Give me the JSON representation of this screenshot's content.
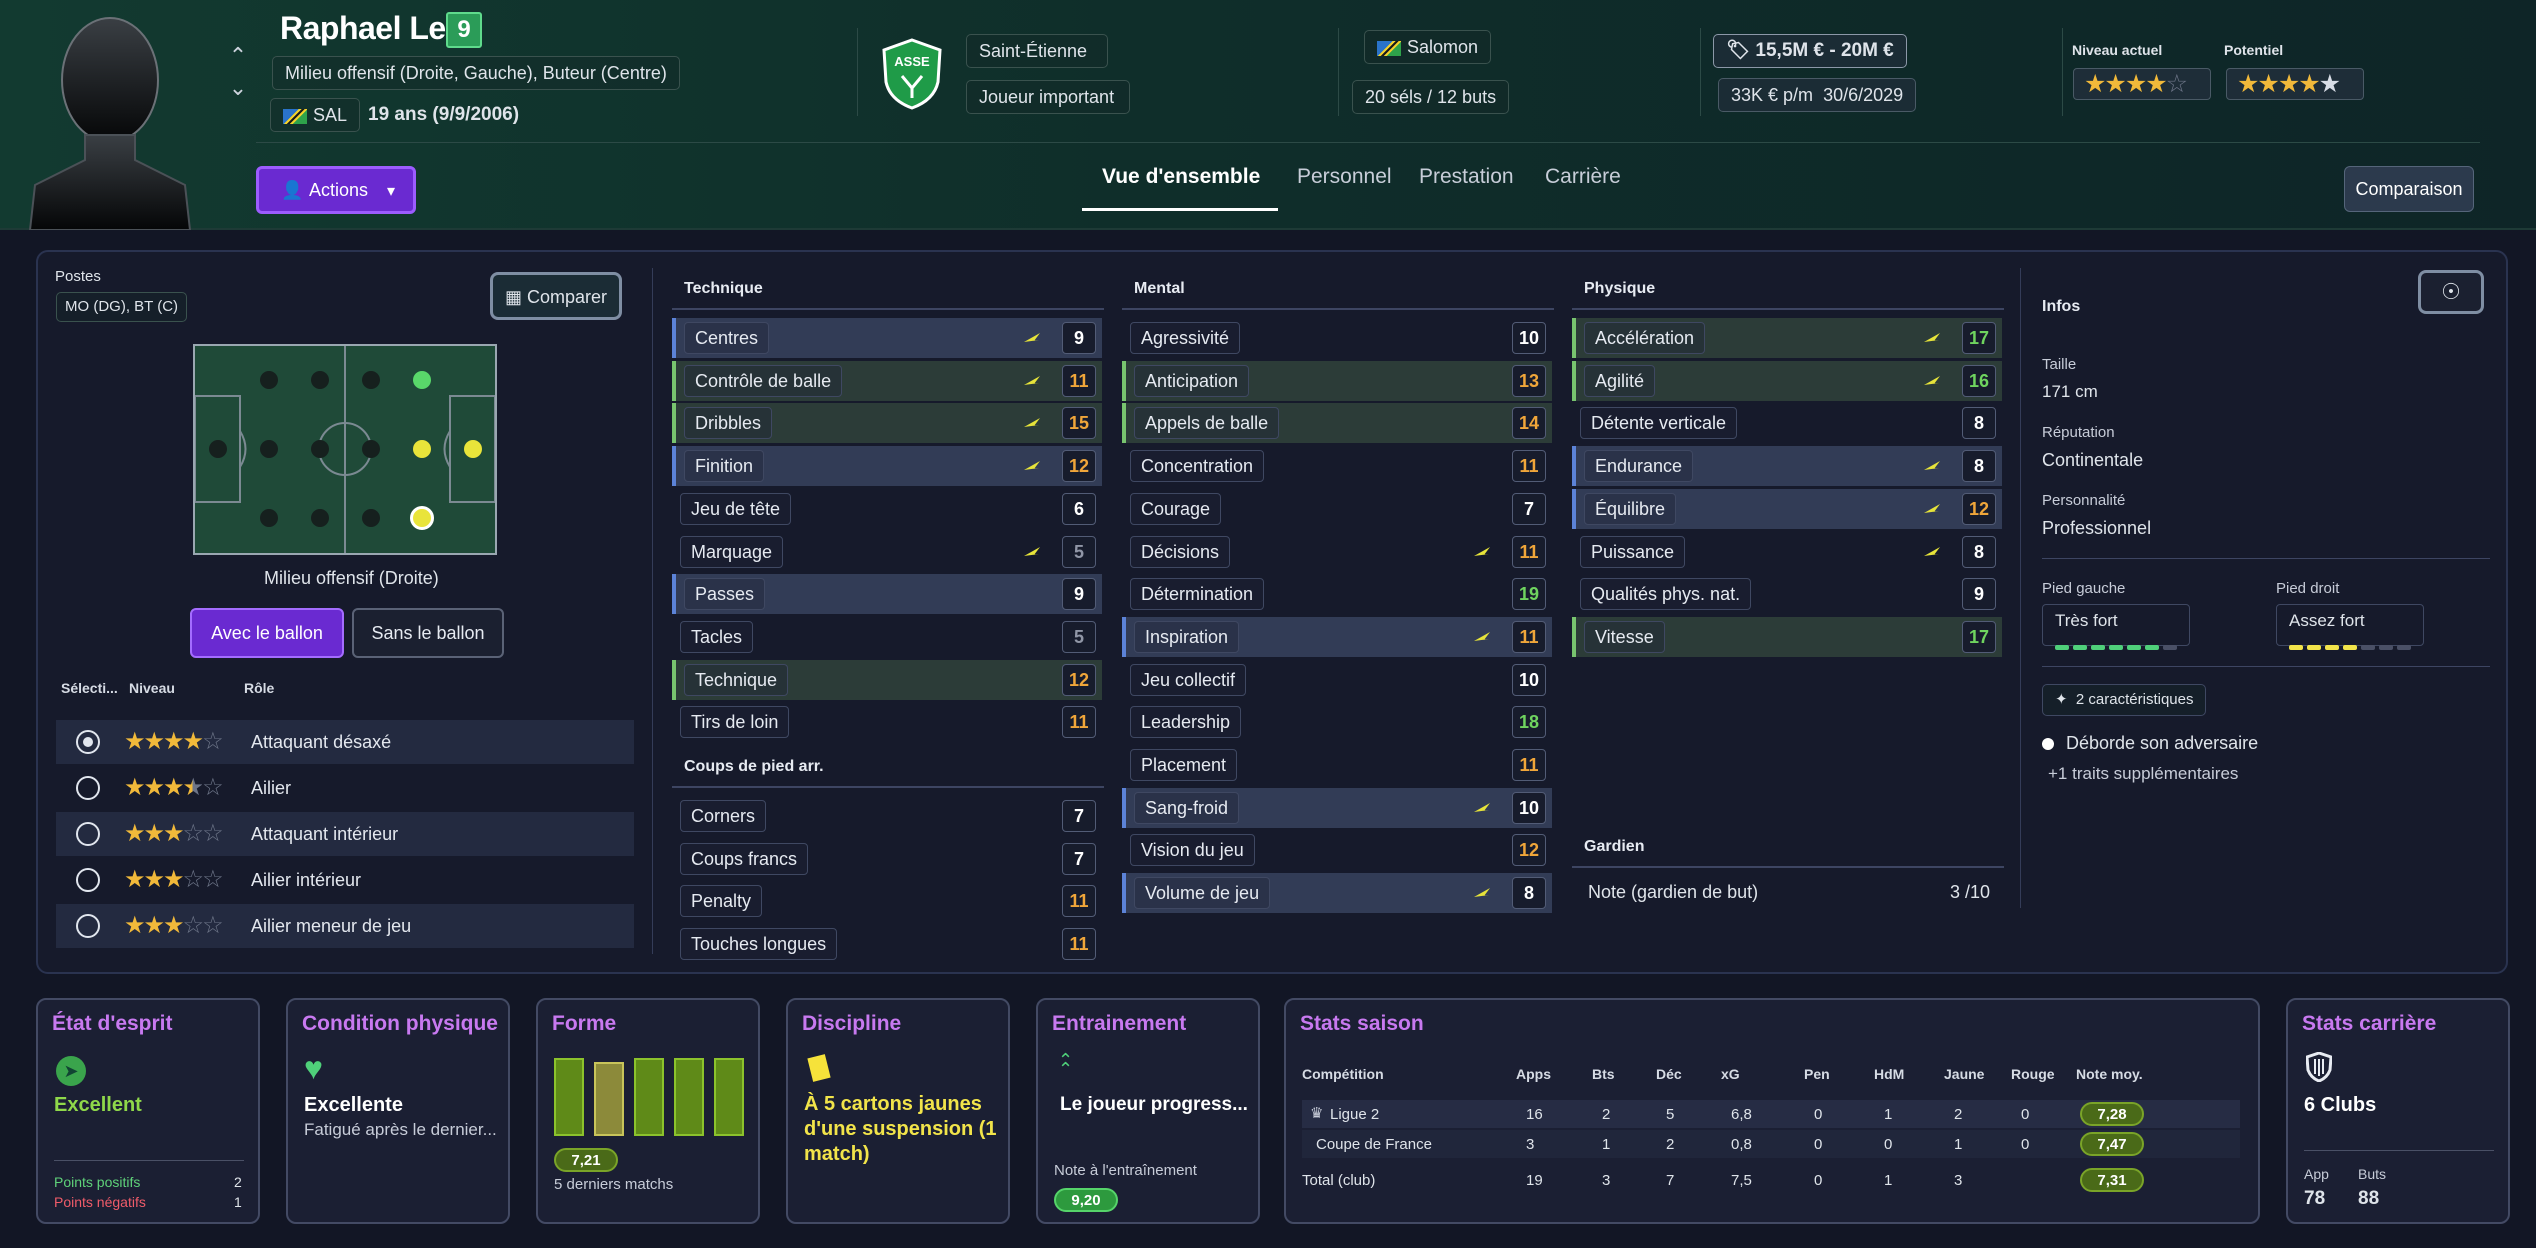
{
  "player": {
    "name": "Raphael Lea'i",
    "number": "9",
    "positions_text": "Milieu offensif (Droite, Gauche), Buteur (Centre)",
    "nation_code": "SAL",
    "age_text": "19 ans (9/9/2006)"
  },
  "club": {
    "name": "Saint-Étienne",
    "role": "Joueur important"
  },
  "nation": {
    "name": "Salomon",
    "caps": "20 séls / 12 buts"
  },
  "value": {
    "range": "15,5M € - 20M €",
    "wage": "33K € p/m",
    "contract_end": "30/6/2029"
  },
  "ratings": {
    "current_label": "Niveau actuel",
    "current_stars": 3.5,
    "potential_label": "Potentiel",
    "potential_stars": 4.5
  },
  "buttons": {
    "actions": "Actions",
    "compare_header": "Comparaison",
    "compare": "Comparer",
    "with_ball": "Avec le ballon",
    "without_ball": "Sans le ballon"
  },
  "tabs": [
    "Vue d'ensemble",
    "Personnel",
    "Prestation",
    "Carrière"
  ],
  "positions": {
    "label": "Postes",
    "value": "MO (DG), BT (C)",
    "current_position": "Milieu offensif (Droite)"
  },
  "roles": {
    "headers": [
      "Sélecti...",
      "Niveau",
      "Rôle"
    ],
    "items": [
      {
        "name": "Attaquant désaxé",
        "stars": 4,
        "selected": true
      },
      {
        "name": "Ailier",
        "stars": 3.5,
        "selected": false
      },
      {
        "name": "Attaquant intérieur",
        "stars": 3,
        "selected": false
      },
      {
        "name": "Ailier intérieur",
        "stars": 3,
        "selected": false
      },
      {
        "name": "Ailier meneur de jeu",
        "stars": 3,
        "selected": false
      }
    ]
  },
  "attributes": {
    "technique_title": "Technique",
    "setpieces_title": "Coups de pied arr.",
    "mental_title": "Mental",
    "physique_title": "Physique",
    "goalkeeper_title": "Gardien",
    "technique": [
      {
        "name": "Centres",
        "value": "9",
        "color": "w",
        "hl": "hl",
        "edge": "bl",
        "key": true
      },
      {
        "name": "Contrôle de balle",
        "value": "11",
        "color": "o",
        "hl": "gr",
        "edge": "gl",
        "key": true
      },
      {
        "name": "Dribbles",
        "value": "15",
        "color": "o",
        "hl": "gr",
        "edge": "gl",
        "key": true
      },
      {
        "name": "Finition",
        "value": "12",
        "color": "o",
        "hl": "hl",
        "edge": "bl",
        "key": true
      },
      {
        "name": "Jeu de tête",
        "value": "6",
        "color": "w",
        "hl": "",
        "edge": "",
        "key": false
      },
      {
        "name": "Marquage",
        "value": "5",
        "color": "gr",
        "hl": "",
        "edge": "",
        "key": true
      },
      {
        "name": "Passes",
        "value": "9",
        "color": "w",
        "hl": "hl",
        "edge": "bl",
        "key": false
      },
      {
        "name": "Tacles",
        "value": "5",
        "color": "gr",
        "hl": "",
        "edge": "",
        "key": false
      },
      {
        "name": "Technique",
        "value": "12",
        "color": "o",
        "hl": "gr",
        "edge": "gl",
        "key": false
      },
      {
        "name": "Tirs de loin",
        "value": "11",
        "color": "o",
        "hl": "",
        "edge": "",
        "key": false
      }
    ],
    "setpieces": [
      {
        "name": "Corners",
        "value": "7",
        "color": "w"
      },
      {
        "name": "Coups francs",
        "value": "7",
        "color": "w"
      },
      {
        "name": "Penalty",
        "value": "11",
        "color": "o"
      },
      {
        "name": "Touches longues",
        "value": "11",
        "color": "o"
      }
    ],
    "mental": [
      {
        "name": "Agressivité",
        "value": "10",
        "color": "w",
        "hl": "",
        "edge": "",
        "key": false
      },
      {
        "name": "Anticipation",
        "value": "13",
        "color": "o",
        "hl": "gr",
        "edge": "gl",
        "key": false
      },
      {
        "name": "Appels de balle",
        "value": "14",
        "color": "o",
        "hl": "gr",
        "edge": "gl",
        "key": false
      },
      {
        "name": "Concentration",
        "value": "11",
        "color": "o",
        "hl": "",
        "edge": "",
        "key": false
      },
      {
        "name": "Courage",
        "value": "7",
        "color": "w",
        "hl": "",
        "edge": "",
        "key": false
      },
      {
        "name": "Décisions",
        "value": "11",
        "color": "o",
        "hl": "",
        "edge": "",
        "key": true
      },
      {
        "name": "Détermination",
        "value": "19",
        "color": "g",
        "hl": "",
        "edge": "",
        "key": false
      },
      {
        "name": "Inspiration",
        "value": "11",
        "color": "o",
        "hl": "hl",
        "edge": "bl",
        "key": true
      },
      {
        "name": "Jeu collectif",
        "value": "10",
        "color": "w",
        "hl": "",
        "edge": "",
        "key": false
      },
      {
        "name": "Leadership",
        "value": "18",
        "color": "g",
        "hl": "",
        "edge": "",
        "key": false
      },
      {
        "name": "Placement",
        "value": "11",
        "color": "o",
        "hl": "",
        "edge": "",
        "key": false
      },
      {
        "name": "Sang-froid",
        "value": "10",
        "color": "w",
        "hl": "hl",
        "edge": "bl",
        "key": true
      },
      {
        "name": "Vision du jeu",
        "value": "12",
        "color": "o",
        "hl": "",
        "edge": "",
        "key": false
      },
      {
        "name": "Volume de jeu",
        "value": "8",
        "color": "w",
        "hl": "hl",
        "edge": "bl",
        "key": true
      }
    ],
    "physique": [
      {
        "name": "Accélération",
        "value": "17",
        "color": "g",
        "hl": "gr",
        "edge": "gl",
        "key": true
      },
      {
        "name": "Agilité",
        "value": "16",
        "color": "g",
        "hl": "gr",
        "edge": "gl",
        "key": true
      },
      {
        "name": "Détente verticale",
        "value": "8",
        "color": "w",
        "hl": "",
        "edge": "",
        "key": false
      },
      {
        "name": "Endurance",
        "value": "8",
        "color": "w",
        "hl": "hl",
        "edge": "bl",
        "key": true
      },
      {
        "name": "Équilibre",
        "value": "12",
        "color": "o",
        "hl": "hl",
        "edge": "bl",
        "key": true
      },
      {
        "name": "Puissance",
        "value": "8",
        "color": "w",
        "hl": "",
        "edge": "",
        "key": true
      },
      {
        "name": "Qualités phys. nat.",
        "value": "9",
        "color": "w",
        "hl": "",
        "edge": "",
        "key": false
      },
      {
        "name": "Vitesse",
        "value": "17",
        "color": "g",
        "hl": "gr",
        "edge": "gl",
        "key": false
      }
    ],
    "goalkeeper_label": "Note (gardien de but)",
    "goalkeeper_value": "3 /10"
  },
  "infos": {
    "title": "Infos",
    "height_label": "Taille",
    "height": "171 cm",
    "reputation_label": "Réputation",
    "reputation": "Continentale",
    "personality_label": "Personnalité",
    "personality": "Professionnel",
    "left_foot_label": "Pied gauche",
    "left_foot": "Très fort",
    "left_foot_level": 6,
    "right_foot_label": "Pied droit",
    "right_foot": "Assez fort",
    "right_foot_level": 4,
    "traits_button": "2 caractéristiques",
    "trait1": "Déborde son adversaire",
    "more_traits": "+1 traits supplémentaires"
  },
  "cards": {
    "mood": {
      "title": "État d'esprit",
      "value": "Excellent",
      "pos_label": "Points positifs",
      "pos": "2",
      "neg_label": "Points négatifs",
      "neg": "1"
    },
    "condition": {
      "title": "Condition physique",
      "value": "Excellente",
      "sub": "Fatigué après le dernier..."
    },
    "form": {
      "title": "Forme",
      "rating": "7,21",
      "sub": "5 derniers matchs"
    },
    "discipline": {
      "title": "Discipline",
      "text": "À 5 cartons jaunes d'une suspension (1 match)"
    },
    "training": {
      "title": "Entrainement",
      "text": "Le joueur progress...",
      "label": "Note à l'entraînement",
      "value": "9,20"
    },
    "season": {
      "title": "Stats saison",
      "headers": [
        "Compétition",
        "Apps",
        "Bts",
        "Déc",
        "xG",
        "Pen",
        "HdM",
        "Jaune",
        "Rouge",
        "Note moy."
      ],
      "rows": [
        [
          "Ligue 2",
          "16",
          "2",
          "5",
          "6,8",
          "0",
          "1",
          "2",
          "0",
          "7,28"
        ],
        [
          "Coupe de France",
          "3",
          "1",
          "2",
          "0,8",
          "0",
          "0",
          "1",
          "0",
          "7,47"
        ],
        [
          "Total (club)",
          "19",
          "3",
          "7",
          "7,5",
          "0",
          "1",
          "3",
          "",
          "7,31"
        ]
      ]
    },
    "career": {
      "title": "Stats carrière",
      "clubs": "6 Clubs",
      "apps_label": "App",
      "apps": "78",
      "goals_label": "Buts",
      "goals": "88"
    }
  },
  "colors": {
    "accent_purple": "#6a2ad1",
    "attr_orange": "#f0a63a",
    "attr_green": "#6fd45f",
    "header_green": "#123a30"
  }
}
